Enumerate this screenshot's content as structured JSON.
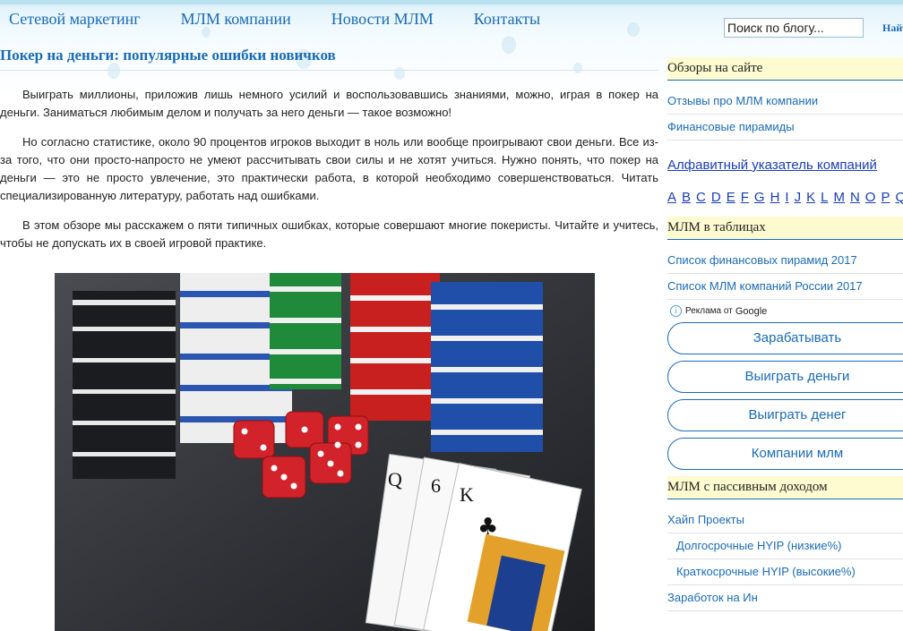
{
  "nav": {
    "items": [
      "Сетевой маркетинг",
      "МЛМ компании",
      "Новости МЛМ",
      "Контакты"
    ]
  },
  "search": {
    "placeholder": "Поиск по блогу...",
    "button": "Найти"
  },
  "post": {
    "title": "Покер на деньги: популярные ошибки новичков",
    "paragraphs": [
      "Выиграть миллионы, приложив лишь немного усилий и воспользовавшись знаниями, можно, играя в покер на деньги. Заниматься любимым делом и получать за него деньги — такое возможно!",
      "Но согласно статистике, около 90 процентов игроков выходит в ноль или вообще проигрывают свои деньги. Все из-за того, что они просто-напросто не умеют рассчитывать свои силы и не хотят учиться. Нужно понять, что покер на деньги — это не просто увлечение, это практически работа, в которой необходимо совершенствоваться. Читать специализированную литературу, работать над ошибками.",
      "В этом обзоре мы расскажем о пяти типичных ошибках, которые совершают многие покеристы. Читайте и учитесь, чтобы не допускать их в своей игровой практике."
    ]
  },
  "sidebar": {
    "reviews_title": "Обзоры на сайте",
    "reviews_links": [
      "Отзывы про МЛМ компании",
      "Финансовые пирамиды"
    ],
    "alphabet_link": "Алфавитный указатель компаний",
    "letters": [
      "A",
      "B",
      "C",
      "D",
      "E",
      "F",
      "G",
      "H",
      "I",
      "J",
      "K",
      "L",
      "M",
      "N",
      "O",
      "P",
      "Q",
      "...."
    ],
    "tables_title": "МЛМ в таблицах",
    "tables_links": [
      "Список финансовых пирамид 2017",
      "Список МЛМ компаний России 2017"
    ],
    "ads_label": "Реклама от",
    "ads_brand": "Google",
    "ad_buttons": [
      "Зарабатывать",
      "Выиграть деньги",
      "Выиграть денег",
      "Компании млм"
    ],
    "passive_title": "МЛМ с пассивным доходом",
    "passive_links": [
      "Хайп Проекты",
      "Долгосрочные HYIP (низкие%)",
      "Краткосрочные HYIP (высокие%)"
    ],
    "cut_link": "Заработок на Ин"
  }
}
